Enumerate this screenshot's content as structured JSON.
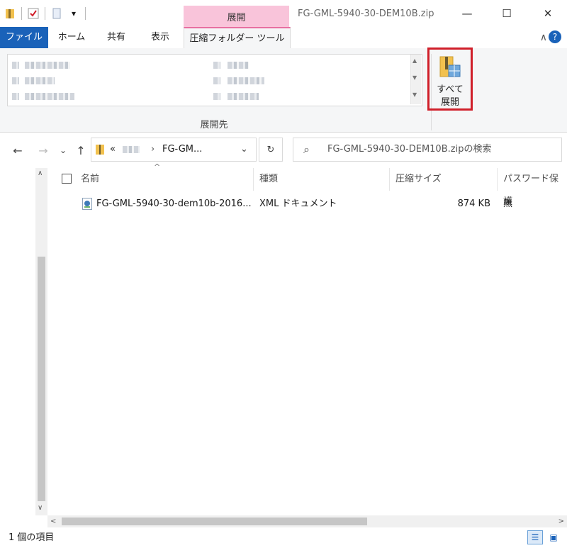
{
  "window": {
    "title": "FG-GML-5940-30-DEM10B.zip",
    "context_tab_label": "展開",
    "controls": {
      "minimize": "—",
      "maximize": "☐",
      "close": "✕"
    }
  },
  "ribbon": {
    "tabs": [
      "ファイル",
      "ホーム",
      "共有",
      "表示",
      "圧縮フォルダー ツール"
    ],
    "group_label": "展開先",
    "extract_all_label": "すべて\n展開",
    "collapse_icon": "∧",
    "help_icon": "?"
  },
  "navigation": {
    "back": "←",
    "forward": "→",
    "recent": "⌄",
    "up": "↑",
    "breadcrumb_prefix": "«",
    "breadcrumb_current": "FG-GM...",
    "breadcrumb_separator": "›",
    "dropdown": "⌄",
    "refresh": "↻"
  },
  "search": {
    "placeholder": "FG-GML-5940-30-DEM10B.zipの検索",
    "icon": "⌕"
  },
  "columns": {
    "name": "名前",
    "type": "種類",
    "size": "圧縮サイズ",
    "password": "パスワード保護",
    "sort_indicator": "^"
  },
  "files": [
    {
      "name": "FG-GML-5940-30-dem10b-2016...",
      "type": "XML ドキュメント",
      "size": "874 KB",
      "password": "無"
    }
  ],
  "status": {
    "text": "1 個の項目"
  },
  "colors": {
    "accent": "#1a62b9",
    "context": "#f9c4da",
    "highlight": "#d01f2a"
  }
}
